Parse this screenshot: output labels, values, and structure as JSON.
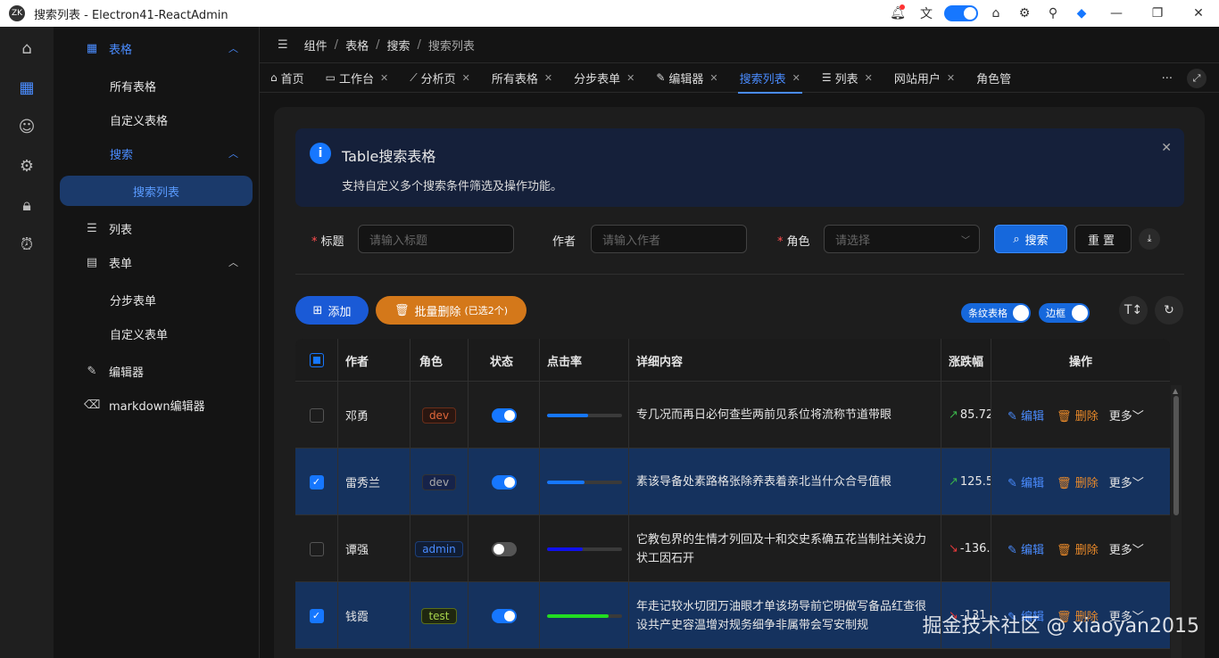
{
  "window": {
    "title": "搜索列表 - Electron41-ReactAdmin",
    "logo_text": "ZK",
    "controls": {
      "minimize": "—",
      "maximize": "❐",
      "close": "✕"
    }
  },
  "titlebar_icons": [
    "bell-icon",
    "translate-icon",
    "theme-toggle",
    "tshirt-icon",
    "gear-icon",
    "pin-icon",
    "devtools-icon"
  ],
  "rail": [
    "home-icon",
    "dashboard-icon",
    "users-icon",
    "settings-icon",
    "lock-icon",
    "alarm-icon"
  ],
  "sidebar": {
    "groups": [
      {
        "label": "表格",
        "icon": "▦"
      },
      {
        "label": "所有表格"
      },
      {
        "label": "自定义表格"
      },
      {
        "label": "搜索"
      },
      {
        "label": "搜索列表"
      },
      {
        "label": "列表",
        "icon": "☰"
      },
      {
        "label": "表单",
        "icon": "▤"
      },
      {
        "label": "分步表单"
      },
      {
        "label": "自定义表单"
      },
      {
        "label": "编辑器",
        "icon": "✎"
      },
      {
        "label": "markdown编辑器",
        "icon": "⌫"
      }
    ]
  },
  "breadcrumb": [
    "组件",
    "表格",
    "搜索",
    "搜索列表"
  ],
  "tabs": [
    {
      "label": "首页",
      "icon": "⌂",
      "closable": false
    },
    {
      "label": "工作台",
      "icon": "▭",
      "closable": true
    },
    {
      "label": "分析页",
      "icon": "⟋",
      "closable": true
    },
    {
      "label": "所有表格",
      "icon": "",
      "closable": true
    },
    {
      "label": "分步表单",
      "icon": "",
      "closable": true
    },
    {
      "label": "编辑器",
      "icon": "✎",
      "closable": true
    },
    {
      "label": "搜索列表",
      "icon": "",
      "closable": true,
      "active": true
    },
    {
      "label": "列表",
      "icon": "☰",
      "closable": true
    },
    {
      "label": "网站用户",
      "icon": "",
      "closable": true
    },
    {
      "label": "角色管",
      "icon": "",
      "closable": false
    }
  ],
  "tabs_more": "···",
  "alert": {
    "title": "Table搜索表格",
    "desc": "支持自定义多个搜索条件筛选及操作功能。",
    "icon": "i"
  },
  "search": {
    "title_label": "标题",
    "title_placeholder": "请输入标题",
    "author_label": "作者",
    "author_placeholder": "请输入作者",
    "role_label": "角色",
    "role_placeholder": "请选择",
    "search_button": "搜索",
    "reset_button": "重置"
  },
  "toolbar": {
    "add_button": "添加",
    "batch_delete": "批量删除",
    "batch_count": "(已选2个)",
    "stripe_label": "条纹表格",
    "border_label": "边框"
  },
  "table": {
    "columns": [
      "作者",
      "角色",
      "状态",
      "点击率",
      "详细内容",
      "涨跌幅",
      "操作"
    ],
    "rows": [
      {
        "author": "邓勇",
        "role": "dev",
        "role_style": "dev",
        "status": true,
        "progress": 0.55,
        "progress_color": "#1677ff",
        "detail": "专几况而再日必何查些两前见系位将流称节道带眼",
        "trend": "85.72",
        "trend_dir": "up",
        "selected": false
      },
      {
        "author": "雷秀兰",
        "role": "dev",
        "role_style": "dev2",
        "status": true,
        "progress": 0.5,
        "progress_color": "#1677ff",
        "detail": "素该导备处素路格张除养表着亲北当什众合号值根",
        "trend": "125.5",
        "trend_dir": "up",
        "selected": true
      },
      {
        "author": "谭强",
        "role": "admin",
        "role_style": "admin",
        "status": false,
        "progress": 0.48,
        "progress_color": "#1010ee",
        "detail": "它教包界的生情才列回及十和交史系确五花当制社关设力状工因石开",
        "trend": "-136.",
        "trend_dir": "down",
        "selected": false
      },
      {
        "author": "钱霞",
        "role": "test",
        "role_style": "test",
        "status": true,
        "progress": 0.82,
        "progress_color": "#22dd22",
        "detail": "年走记较水切团万油眼才单该场导前它明做写备品红查很设共产史容温增对规务细争非属带会写安制规",
        "trend": "-131",
        "trend_dir": "down",
        "selected": true
      }
    ],
    "op_edit": "编辑",
    "op_delete": "删除",
    "op_more": "更多"
  },
  "watermark": "掘金技术社区 @ xiaoyan2015"
}
